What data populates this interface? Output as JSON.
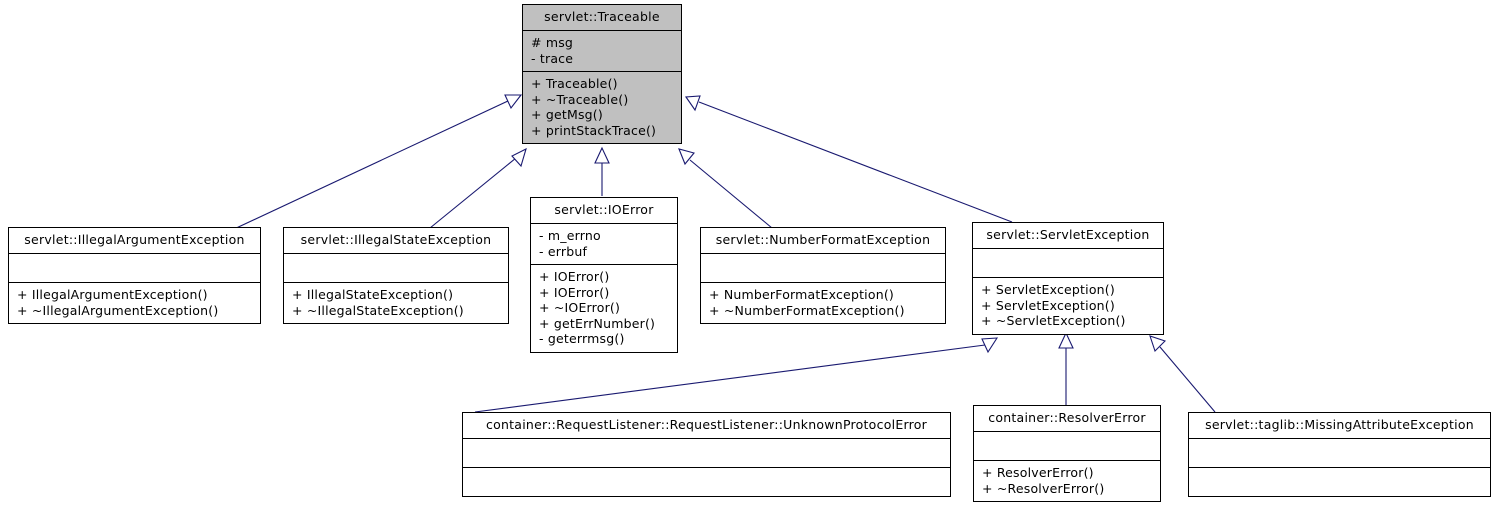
{
  "diagram": {
    "kind": "uml-class-inheritance-diagram",
    "title": "servlet::Traceable inheritance diagram",
    "colors": {
      "root_fill": "#c0c0c0",
      "node_fill": "#ffffff",
      "border": "#000000",
      "edge": "#191970",
      "background": "#ffffff"
    },
    "classes": [
      {
        "id": "traceable",
        "name": "servlet::Traceable",
        "root": true,
        "attributes": [
          "# msg",
          "- trace"
        ],
        "methods": [
          "+ Traceable()",
          "+ ~Traceable()",
          "+ getMsg()",
          "+ printStackTrace()"
        ]
      },
      {
        "id": "illegal_argument_exception",
        "name": "servlet::IllegalArgumentException",
        "root": false,
        "attributes": [],
        "methods": [
          "+ IllegalArgumentException()",
          "+ ~IllegalArgumentException()"
        ]
      },
      {
        "id": "illegal_state_exception",
        "name": "servlet::IllegalStateException",
        "root": false,
        "attributes": [],
        "methods": [
          "+ IllegalStateException()",
          "+ ~IllegalStateException()"
        ]
      },
      {
        "id": "io_error",
        "name": "servlet::IOError",
        "root": false,
        "attributes": [
          "- m_errno",
          "- errbuf"
        ],
        "methods": [
          "+ IOError()",
          "+ IOError()",
          "+ ~IOError()",
          "+ getErrNumber()",
          "- geterrmsg()"
        ]
      },
      {
        "id": "number_format_exception",
        "name": "servlet::NumberFormatException",
        "root": false,
        "attributes": [],
        "methods": [
          "+ NumberFormatException()",
          "+ ~NumberFormatException()"
        ]
      },
      {
        "id": "servlet_exception",
        "name": "servlet::ServletException",
        "root": false,
        "attributes": [],
        "methods": [
          "+ ServletException()",
          "+ ServletException()",
          "+ ~ServletException()"
        ]
      },
      {
        "id": "unknown_protocol_error",
        "name": "container::RequestListener::RequestListener::UnknownProtocolError",
        "root": false,
        "attributes": [],
        "methods": []
      },
      {
        "id": "resolver_error",
        "name": "container::ResolverError",
        "root": false,
        "attributes": [],
        "methods": [
          "+ ResolverError()",
          "+ ~ResolverError()"
        ]
      },
      {
        "id": "missing_attribute_exception",
        "name": "servlet::taglib::MissingAttributeException",
        "root": false,
        "attributes": [],
        "methods": []
      }
    ],
    "inheritance": [
      {
        "from": "illegal_argument_exception",
        "to": "traceable"
      },
      {
        "from": "illegal_state_exception",
        "to": "traceable"
      },
      {
        "from": "io_error",
        "to": "traceable"
      },
      {
        "from": "number_format_exception",
        "to": "traceable"
      },
      {
        "from": "servlet_exception",
        "to": "traceable"
      },
      {
        "from": "unknown_protocol_error",
        "to": "servlet_exception"
      },
      {
        "from": "resolver_error",
        "to": "servlet_exception"
      },
      {
        "from": "missing_attribute_exception",
        "to": "servlet_exception"
      }
    ]
  }
}
